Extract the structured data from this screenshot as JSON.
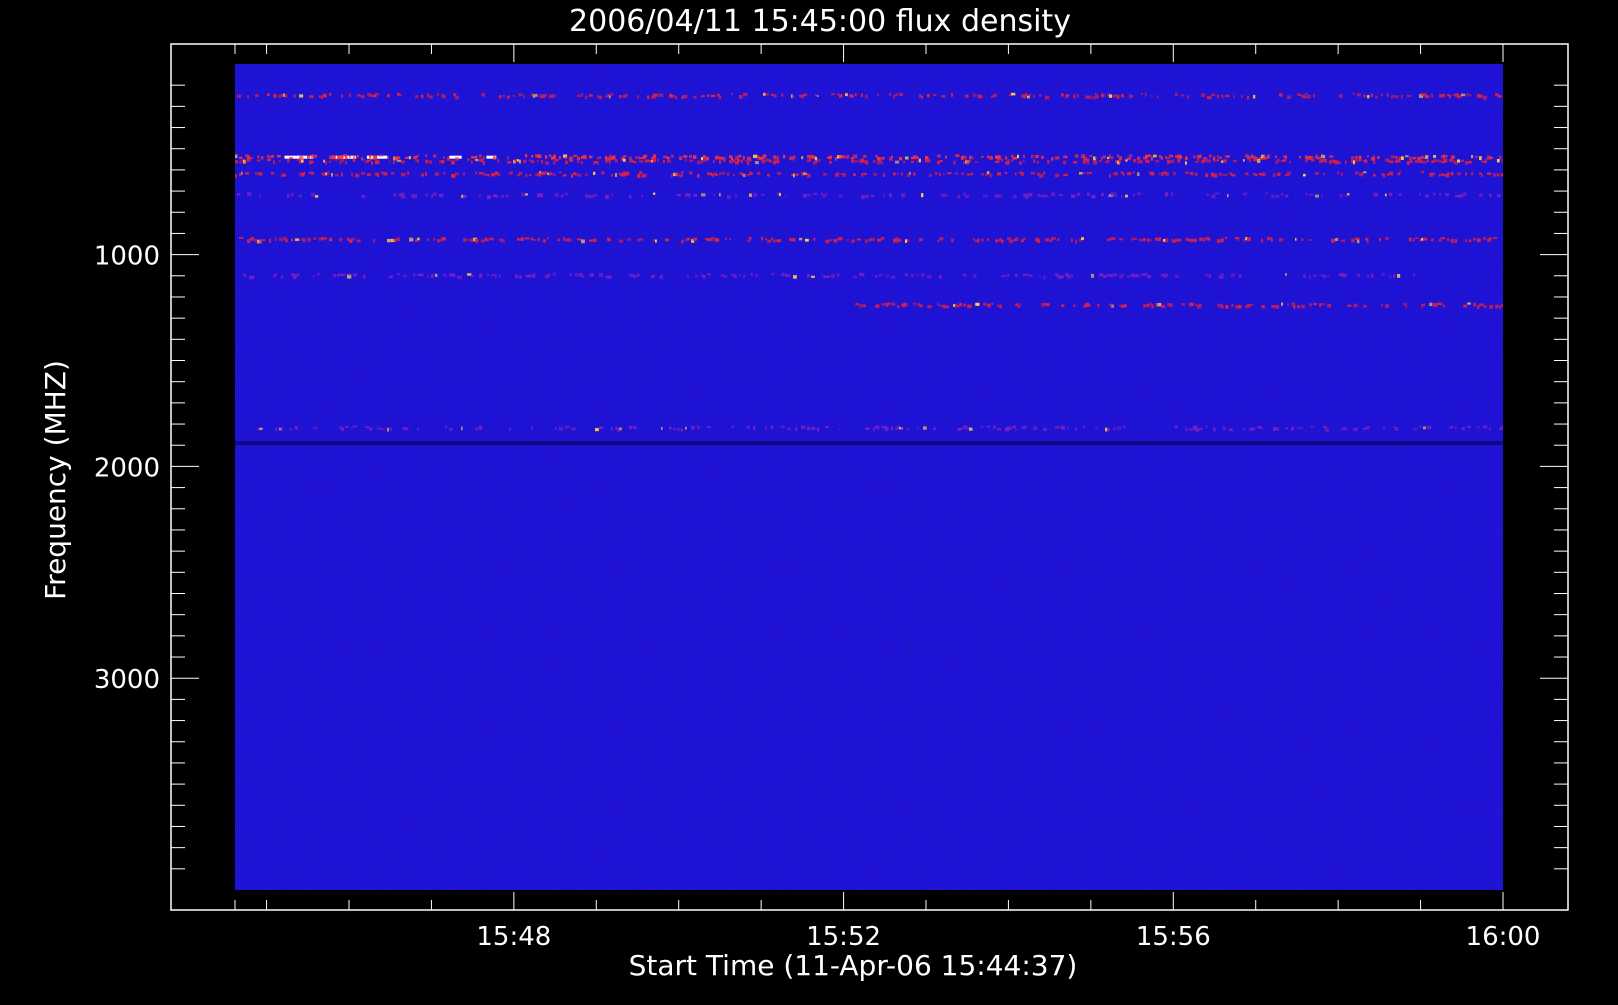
{
  "chart_data": {
    "type": "heatmap",
    "title": "2006/04/11 15:45:00 flux density",
    "xlabel": "Start Time (11-Apr-06 15:44:37)",
    "ylabel": "Frequency (MHZ)",
    "x_tick_labels": [
      "15:48",
      "15:52",
      "15:56",
      "16:00"
    ],
    "x_tick_values_min": [
      3.383,
      7.383,
      11.383,
      15.383
    ],
    "x_range_min": [
      0,
      15.383
    ],
    "y_tick_labels": [
      "1000",
      "2000",
      "3000"
    ],
    "y_tick_values": [
      1000,
      2000,
      3000
    ],
    "y_range": [
      100,
      4000
    ],
    "y_reversed": true,
    "grid": false,
    "colormap": {
      "background": "#1a10e0",
      "low": "#0a0a70",
      "mid": "#ff2020",
      "high": "#ffffff"
    },
    "features": [
      {
        "kind": "rfi-band",
        "freq_mhz": 250,
        "intensity": "medium"
      },
      {
        "kind": "rfi-band",
        "freq_mhz": 540,
        "intensity": "high",
        "segments_min": [
          [
            0.6,
            0.8
          ],
          [
            0.75,
            0.95
          ],
          [
            1.22,
            1.47
          ],
          [
            1.6,
            1.85
          ],
          [
            2.6,
            2.75
          ],
          [
            3.05,
            3.17
          ]
        ]
      },
      {
        "kind": "rfi-band",
        "freq_mhz": 560,
        "intensity": "medium"
      },
      {
        "kind": "rfi-band",
        "freq_mhz": 620,
        "intensity": "medium"
      },
      {
        "kind": "rfi-band",
        "freq_mhz": 720,
        "intensity": "low"
      },
      {
        "kind": "rfi-band",
        "freq_mhz": 930,
        "intensity": "medium"
      },
      {
        "kind": "rfi-band",
        "freq_mhz": 1100,
        "intensity": "low"
      },
      {
        "kind": "rfi-band",
        "freq_mhz": 1240,
        "intensity": "medium",
        "from_min": 7.5
      },
      {
        "kind": "rfi-band",
        "freq_mhz": 1820,
        "intensity": "low"
      },
      {
        "kind": "dark-band",
        "freq_mhz": 1890
      }
    ]
  }
}
